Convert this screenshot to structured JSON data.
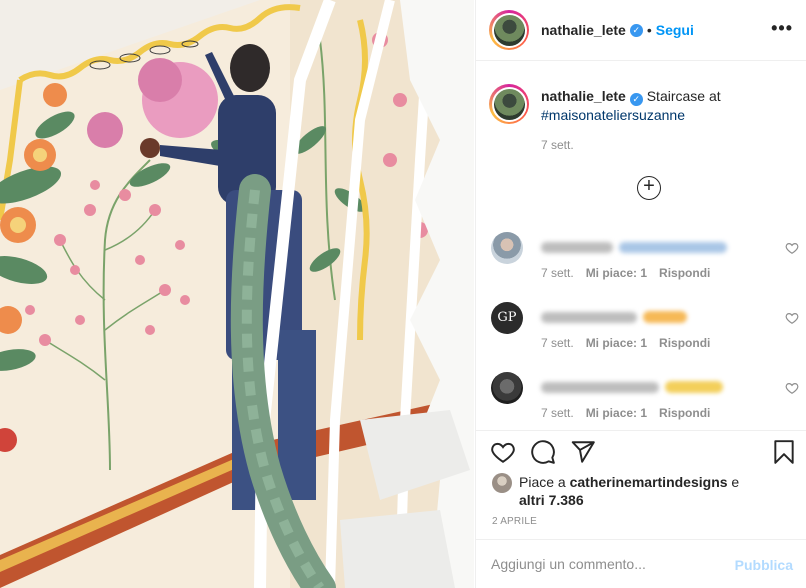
{
  "post": {
    "media_alt": "",
    "author": {
      "username": "nathalie_lete",
      "verified_icon": "verified-badge-icon",
      "follow_separator": "•",
      "follow_label": "Segui"
    },
    "more_label": "•••",
    "caption": {
      "username": "nathalie_lete",
      "text": "Staircase at",
      "hashtag": "#maisonateliersuzanne",
      "time": "7 sett."
    },
    "load_more_label": "+",
    "comments": [
      {
        "time": "7 sett.",
        "likes": "Mi piace: 1",
        "reply": "Rispondi"
      },
      {
        "time": "7 sett.",
        "likes": "Mi piace: 1",
        "reply": "Rispondi"
      },
      {
        "time": "7 sett.",
        "likes": "Mi piace: 1",
        "reply": "Rispondi"
      }
    ],
    "likes": {
      "prefix": "Piace a",
      "user": "catherinemartindesigns",
      "conjunction": "e",
      "others": "altri 7.386"
    },
    "date": "2 APRILE",
    "add_comment": {
      "placeholder": "Aggiungi un commento...",
      "publish_label": "Pubblica"
    }
  },
  "icons": [
    "like-heart-icon",
    "comment-bubble-icon",
    "share-paper-plane-icon",
    "save-bookmark-icon",
    "add-circle-icon",
    "more-options-icon"
  ],
  "colors": {
    "link_blue": "#0095f6",
    "hashtag_blue": "#00376b",
    "text": "#262626",
    "muted": "#8e8e8e",
    "publish_disabled": "#b3dbff",
    "divider": "#efefef"
  }
}
